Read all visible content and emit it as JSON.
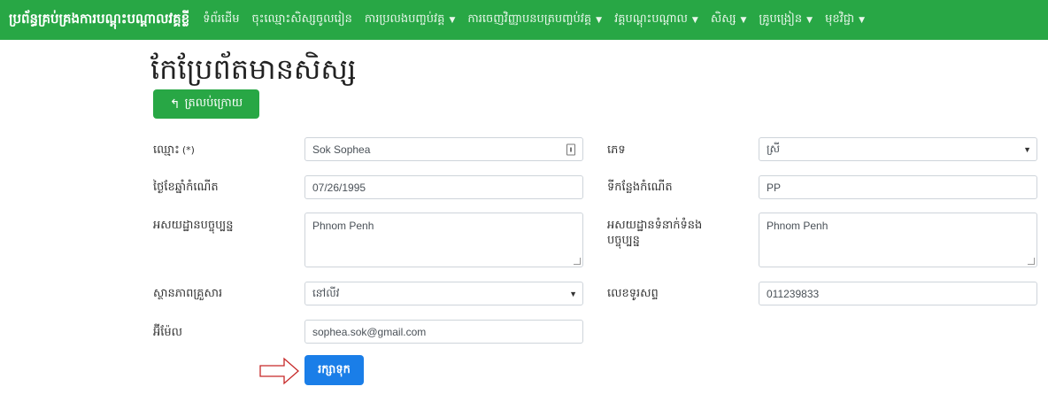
{
  "nav": {
    "brand": "ប្រព័ន្ធគ្រប់គ្រងការបណ្ដុះបណ្ដាលវគ្គខ្លី",
    "items": [
      {
        "label": "ទំព័រដើម",
        "dropdown": false
      },
      {
        "label": "ចុះឈ្មោះសិស្សចូលរៀន",
        "dropdown": false
      },
      {
        "label": "ការប្រលងបញ្ចប់វគ្គ",
        "dropdown": true
      },
      {
        "label": "ការចេញវិញ្ញាបនបត្របញ្ចប់វគ្គ",
        "dropdown": true
      },
      {
        "label": "វគ្គបណ្ដុះបណ្ដាល",
        "dropdown": true
      },
      {
        "label": "សិស្ស",
        "dropdown": true
      },
      {
        "label": "គ្រូបង្រៀន",
        "dropdown": true
      },
      {
        "label": "មុខវិជ្ជា",
        "dropdown": true
      }
    ],
    "color": "#28a745"
  },
  "page": {
    "title": "កែប្រែព័តមានសិស្ស",
    "back_label": "ត្រលប់ក្រោយ",
    "save_label": "រក្សាទុក"
  },
  "form": {
    "name": {
      "label": "ឈ្មោះ",
      "required_mark": "(*)",
      "value": "Sok Sophea"
    },
    "gender": {
      "label": "ភេទ",
      "value": "ស្រី"
    },
    "dob": {
      "label": "ថ្ងៃខែឆ្នាំកំណើត",
      "value": "07/26/1995"
    },
    "birthplace": {
      "label": "ទីកន្លែងកំណើត",
      "value": "PP"
    },
    "current_address": {
      "label": "អសយដ្ឋានបច្ចុប្បន្ន",
      "value": "Phnom Penh"
    },
    "contact_address": {
      "label": "អសយដ្ឋានទំនាក់ទំនងបច្ចុប្បន្ន",
      "value": "Phnom Penh"
    },
    "family_status": {
      "label": "ស្ថានភាពគ្រួសារ",
      "value": "នៅលីវ"
    },
    "phone": {
      "label": "លេខទូរសព្ទ",
      "value": "011239833"
    },
    "email": {
      "label": "អ៊ីម៉ែល",
      "value": "sophea.sok@gmail.com"
    }
  },
  "colors": {
    "primary": "#1a7ee8",
    "success": "#28a745",
    "arrow": "#c62828"
  }
}
